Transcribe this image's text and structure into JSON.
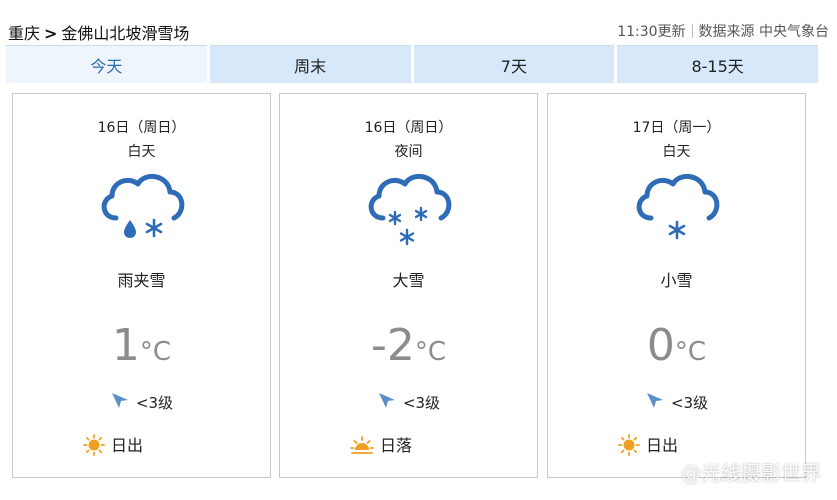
{
  "breadcrumb": {
    "region": "重庆",
    "separator": ">",
    "location": "金佛山北坡滑雪场"
  },
  "update": {
    "time_text": "11:30更新",
    "source_text": "数据来源 中央气象台"
  },
  "tabs": [
    {
      "label": "今天",
      "active": true
    },
    {
      "label": "周末",
      "active": false
    },
    {
      "label": "7天",
      "active": false
    },
    {
      "label": "8-15天",
      "active": false
    }
  ],
  "forecast": [
    {
      "date": "16日（周日）",
      "period": "白天",
      "icon": "rain-snow-icon",
      "condition": "雨夹雪",
      "temp": "1",
      "temp_unit": "°C",
      "wind": "<3级",
      "sun_label": "日出",
      "sun_icon": "sunrise-icon"
    },
    {
      "date": "16日（周日）",
      "period": "夜间",
      "icon": "heavy-snow-icon",
      "condition": "大雪",
      "temp": "-2",
      "temp_unit": "°C",
      "wind": "<3级",
      "sun_label": "日落",
      "sun_icon": "sunset-icon"
    },
    {
      "date": "17日（周一）",
      "period": "白天",
      "icon": "light-snow-icon",
      "condition": "小雪",
      "temp": "0",
      "temp_unit": "°C",
      "wind": "<3级",
      "sun_label": "日出",
      "sun_icon": "sunrise-icon"
    }
  ],
  "watermark": "@光线摄影世界",
  "colors": {
    "icon_blue": "#2e6cb8",
    "tab_bg": "#d6e8fa",
    "tab_active_bg": "#eef5fd",
    "temp_gray": "#8c8c8c",
    "sun_orange": "#f0a020"
  }
}
